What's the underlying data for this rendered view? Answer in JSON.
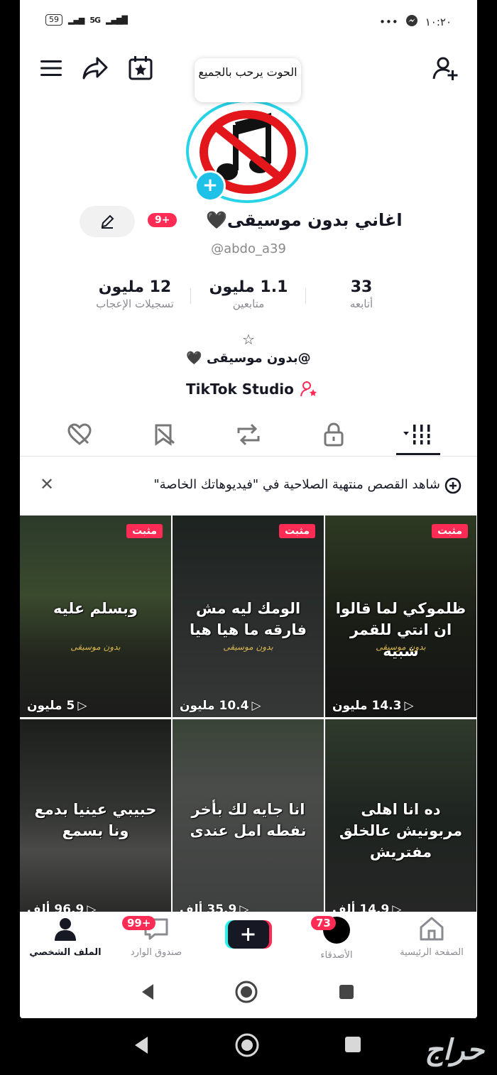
{
  "status_bar": {
    "battery": "59",
    "network": "5G",
    "time": "١٠:٢٠",
    "dots": "•••"
  },
  "header": {
    "tooltip": "الحوت يرحب بالجميع",
    "menu_icon": "hamburger-icon",
    "share_icon": "share-icon",
    "calendar_icon": "calendar-star-icon",
    "add_friend_icon": "add-user-icon"
  },
  "profile": {
    "display_name": "اغاني بدون موسيقى🖤",
    "notification_badge": "9+",
    "handle": "@abdo_a39",
    "bio_star": "☆",
    "bio_line": "@بدون موسيقى 🖤",
    "studio_label": "TikTok Studio"
  },
  "stats": {
    "following": {
      "value": "33",
      "label": "أتابعه"
    },
    "followers": {
      "value": "1.1 مليون",
      "label": "متابعين"
    },
    "likes": {
      "value": "12 مليون",
      "label": "تسجيلات الإعجاب"
    }
  },
  "banner": {
    "text": "شاهد القصص منتهية الصلاحية في \"فيديوهاتك الخاصة\"",
    "close": "✕"
  },
  "videos": [
    {
      "pinned": "مثبت",
      "caption": "ظلموكي لما قالوا ان انتي للقمر شبيه",
      "signature": "بدون موسيقى",
      "views": "14.3 مليون"
    },
    {
      "pinned": "مثبت",
      "caption": "الومك ليه مش فارقه ما هيا هيا",
      "signature": "بدون موسيقى",
      "views": "10.4 مليون"
    },
    {
      "pinned": "مثبت",
      "caption": "وبسلم عليه",
      "signature": "بدون موسيقى",
      "views": "5 مليون"
    },
    {
      "pinned": "",
      "caption": "ده انا اهلى مربونيش عالخلق مفتريش",
      "signature": "",
      "views": "14.9 ألف"
    },
    {
      "pinned": "",
      "caption": "انا جايه لك بأخر نفطه امل عندى",
      "signature": "",
      "views": "35.9 ألف"
    },
    {
      "pinned": "",
      "caption": "حبيبي عينيا بدمع ونا بسمع",
      "signature": "",
      "views": "96.9 ألف"
    }
  ],
  "bottom_nav": {
    "home": "الصفحة الرئيسية",
    "friends": "الأصدقاء",
    "friends_badge": "73",
    "create": "+",
    "inbox": "صندوق الوارد",
    "inbox_badge": "99+",
    "profile": "الملف الشخصي"
  },
  "watermark": "حراج"
}
